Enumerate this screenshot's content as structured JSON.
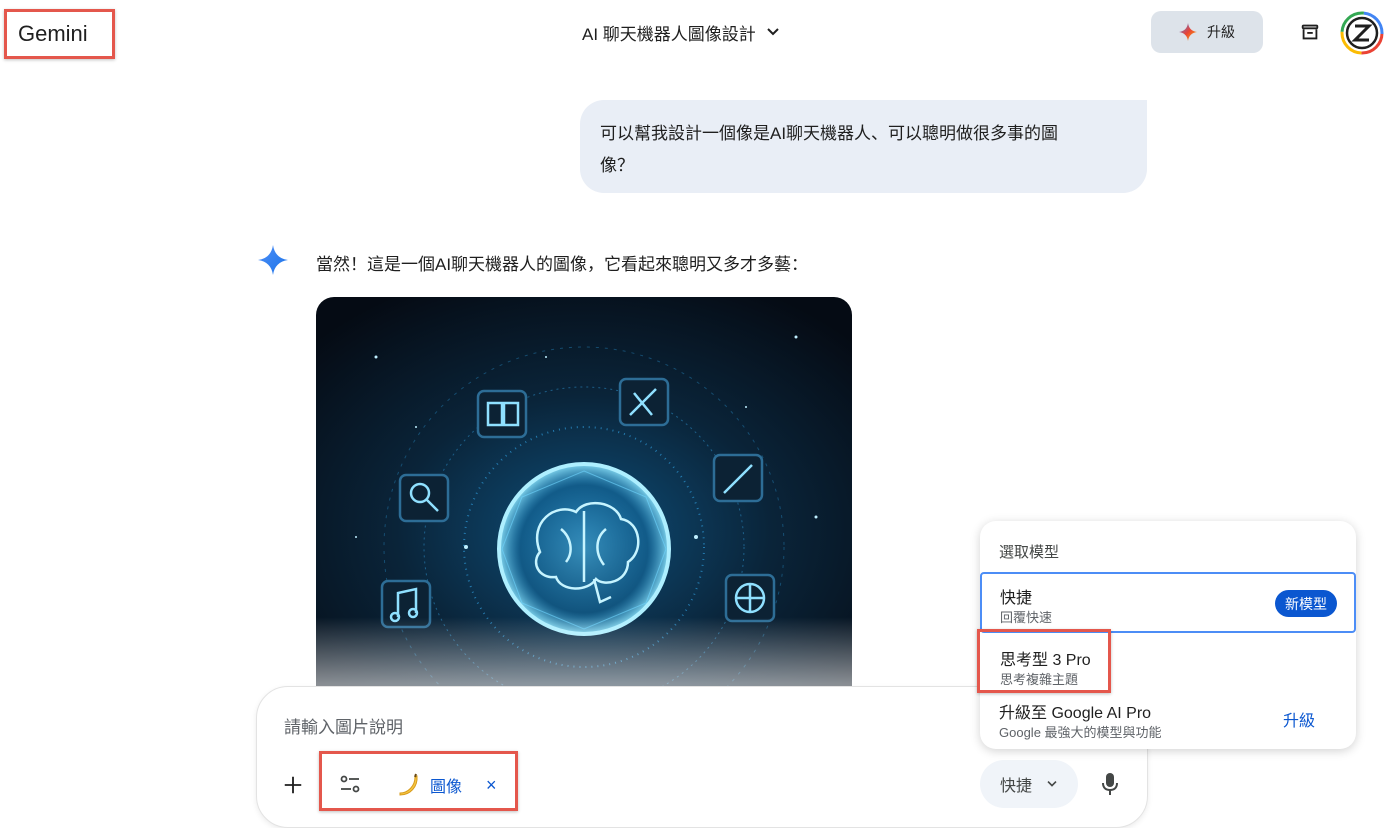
{
  "header": {
    "app_name": "Gemini",
    "conversation_title": "AI 聊天機器人圖像設計",
    "upgrade_label": "升級"
  },
  "chat": {
    "user_message_line1": "可以幫我設計一個像是AI聊天機器人、可以聰明做很多事的圖",
    "user_message_line2": "像？",
    "model_reply": "當然！這是一個AI聊天機器人的圖像，它看起來聰明又多才多藝："
  },
  "composer": {
    "placeholder": "請輸入圖片說明",
    "tool_chip_label": "圖像",
    "tool_chip_close": "×",
    "mode_label": "快捷"
  },
  "model_menu": {
    "title": "選取模型",
    "options": [
      {
        "name": "快捷",
        "description": "回覆快速",
        "badge": "新模型"
      },
      {
        "name": "思考型 3 Pro",
        "description": "思考複雜主題"
      },
      {
        "name": "升級至 Google AI Pro",
        "description": "Google 最強大的模型與功能",
        "action": "升級"
      }
    ]
  },
  "colors": {
    "accent_blue": "#0b57d0",
    "highlight_red": "#e4574c",
    "user_bubble": "#e9eef6",
    "selected_border": "#4c8df6"
  },
  "icons": [
    "chevron-down-icon",
    "sparkle-icon",
    "clear-history-icon",
    "avatar-icon",
    "gemini-spark-icon",
    "plus-icon",
    "tools-icon",
    "banana-icon",
    "close-icon",
    "mic-icon"
  ]
}
